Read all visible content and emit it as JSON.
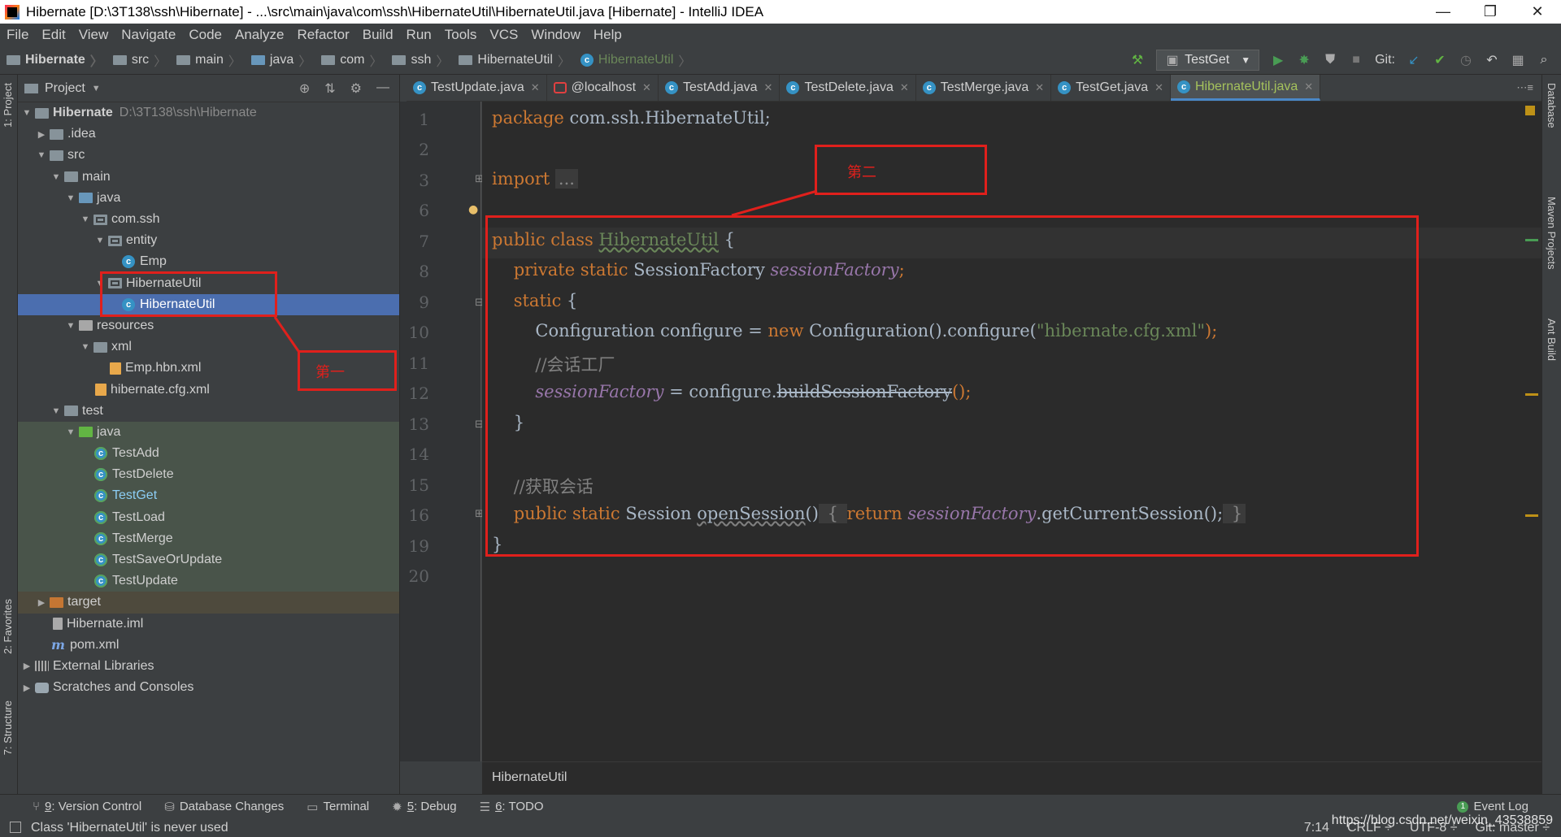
{
  "window": {
    "title": "Hibernate [D:\\3T138\\ssh\\Hibernate] - ...\\src\\main\\java\\com\\ssh\\HibernateUtil\\HibernateUtil.java [Hibernate] - IntelliJ IDEA",
    "minimize": "—",
    "restore": "❐",
    "close": "✕"
  },
  "menu": [
    "File",
    "Edit",
    "View",
    "Navigate",
    "Code",
    "Analyze",
    "Refactor",
    "Build",
    "Run",
    "Tools",
    "VCS",
    "Window",
    "Help"
  ],
  "navbar": {
    "crumbs": [
      "Hibernate",
      "src",
      "main",
      "java",
      "com",
      "ssh",
      "HibernateUtil",
      "HibernateUtil"
    ],
    "run_config": "TestGet",
    "git_label": "Git:"
  },
  "project_panel": {
    "title": "Project",
    "tree": [
      {
        "label": "Hibernate",
        "hint": "D:\\3T138\\ssh\\Hibernate"
      },
      {
        "label": ".idea"
      },
      {
        "label": "src"
      },
      {
        "label": "main"
      },
      {
        "label": "java"
      },
      {
        "label": "com.ssh"
      },
      {
        "label": "entity"
      },
      {
        "label": "Emp"
      },
      {
        "label": "HibernateUtil"
      },
      {
        "label": "HibernateUtil"
      },
      {
        "label": "resources"
      },
      {
        "label": "xml"
      },
      {
        "label": "Emp.hbn.xml"
      },
      {
        "label": "hibernate.cfg.xml"
      },
      {
        "label": "test"
      },
      {
        "label": "java"
      },
      {
        "label": "TestAdd"
      },
      {
        "label": "TestDelete"
      },
      {
        "label": "TestGet"
      },
      {
        "label": "TestLoad"
      },
      {
        "label": "TestMerge"
      },
      {
        "label": "TestSaveOrUpdate"
      },
      {
        "label": "TestUpdate"
      },
      {
        "label": "target"
      },
      {
        "label": "Hibernate.iml"
      },
      {
        "label": "pom.xml"
      },
      {
        "label": "External Libraries"
      },
      {
        "label": "Scratches and Consoles"
      }
    ]
  },
  "left_stripe": {
    "project": "1: Project",
    "favorites": "2: Favorites",
    "structure": "7: Structure"
  },
  "right_stripe": {
    "database": "Database",
    "maven": "Maven Projects",
    "ant": "Ant Build"
  },
  "tabs": [
    "TestUpdate.java",
    "@localhost",
    "TestAdd.java",
    "TestDelete.java",
    "TestMerge.java",
    "TestGet.java",
    "HibernateUtil.java"
  ],
  "editor": {
    "line_numbers": [
      "1",
      "2",
      "3",
      "6",
      "7",
      "8",
      "9",
      "10",
      "11",
      "12",
      "13",
      "14",
      "15",
      "16",
      "19",
      "20"
    ],
    "code": {
      "l1_kw": "package",
      "l1_rest": " com.ssh.HibernateUtil;",
      "l3_kw": "import",
      "l3_fold": "...",
      "l7_kw": "public class",
      "l7_cls": "HibernateUtil",
      "l7_rest": " {",
      "l8_kw": "private static",
      "l8_type": " SessionFactory ",
      "l8_fld": "sessionFactory",
      "l8_end": ";",
      "l9_kw": "static",
      "l9_rest": " {",
      "l10_a": "Configuration configure = ",
      "l10_kw": "new",
      "l10_b": " Configuration().configure(",
      "l10_str": "\"hibernate.cfg.xml\"",
      "l10_c": ");",
      "l11_cmt": "//会话工厂",
      "l12_fld": "sessionFactory",
      "l12_a": " = configure.",
      "l12_strike": "buildSessionFactory",
      "l12_b": "();",
      "l13": "}",
      "l15_cmt": "//获取会话",
      "l16_kw": "public static",
      "l16_type": " Session ",
      "l16_m": "openSession",
      "l16_p": "()",
      "l16_ob": " { ",
      "l16_ret": "return",
      "l16_fld": "sessionFactory",
      "l16_rest": ".getCurrentSession();",
      "l16_cb": " }",
      "l19": "}"
    },
    "bottom_crumb": "HibernateUtil"
  },
  "annotations": {
    "first": "第一",
    "second": "第二"
  },
  "bottom_tools": [
    {
      "num": "9",
      "label": ": Version Control"
    },
    {
      "num": "",
      "label": "Database Changes"
    },
    {
      "num": "",
      "label": "Terminal"
    },
    {
      "num": "5",
      "label": ": Debug"
    },
    {
      "num": "6",
      "label": ": TODO"
    }
  ],
  "event_log": "Event Log",
  "status": {
    "message": "Class 'HibernateUtil' is never used",
    "position": "7:14",
    "line_sep": "CRLF ÷",
    "encoding": "UTF-8 ÷",
    "branch": "Git: master ÷"
  },
  "watermark": "https://blog.csdn.net/weixin_43538859"
}
